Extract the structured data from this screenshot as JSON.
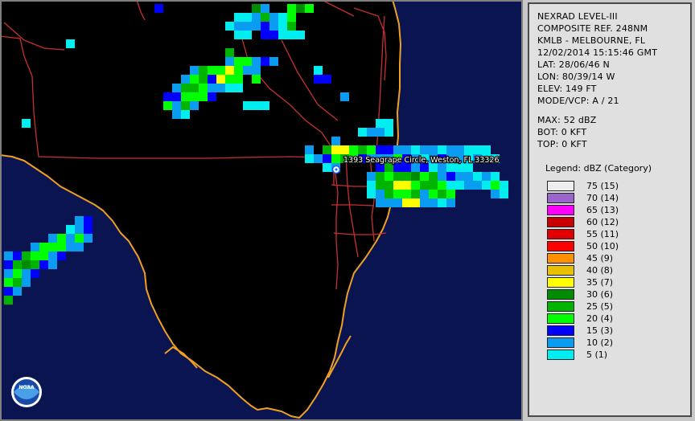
{
  "map": {
    "location_label": "1393 Seagrape Circle, Weston, FL 33326",
    "logo_text": "NOAA",
    "colors": {
      "ocean": "#0a1450",
      "land": "#000000",
      "coastline": "#f0a020",
      "roads": "#c83030",
      "frame": "#7f7f7f"
    }
  },
  "info": {
    "lines": [
      "NEXRAD LEVEL-III",
      "COMPOSITE REF. 248NM",
      "KMLB - MELBOURNE, FL",
      "12/02/2014 15:15:46 GMT",
      "LAT: 28/06/46 N",
      "LON: 80/39/14 W",
      "ELEV: 149 FT",
      "MODE/VCP: A / 21"
    ],
    "stats": [
      "MAX: 52 dBZ",
      "BOT: 0 KFT",
      "TOP: 0 KFT"
    ]
  },
  "legend": {
    "title": "Legend: dBZ (Category)",
    "entries": [
      {
        "label": "75  (15)",
        "color": "#eeeeee"
      },
      {
        "label": "70  (14)",
        "color": "#9966cc"
      },
      {
        "label": "65  (13)",
        "color": "#ff00ff"
      },
      {
        "label": "60  (12)",
        "color": "#c80000"
      },
      {
        "label": "55  (11)",
        "color": "#e00000"
      },
      {
        "label": "50  (10)",
        "color": "#ff0000"
      },
      {
        "label": "45  (9)",
        "color": "#ff9000"
      },
      {
        "label": "40  (8)",
        "color": "#e8c000"
      },
      {
        "label": "35  (7)",
        "color": "#ffff00"
      },
      {
        "label": "30  (6)",
        "color": "#008c00"
      },
      {
        "label": "25  (5)",
        "color": "#00b400"
      },
      {
        "label": "20  (4)",
        "color": "#00ff00"
      },
      {
        "label": "15  (3)",
        "color": "#0000ff"
      },
      {
        "label": "10  (2)",
        "color": "#0a9cf0"
      },
      {
        "label": "5  (1)",
        "color": "#00eef0"
      }
    ]
  }
}
